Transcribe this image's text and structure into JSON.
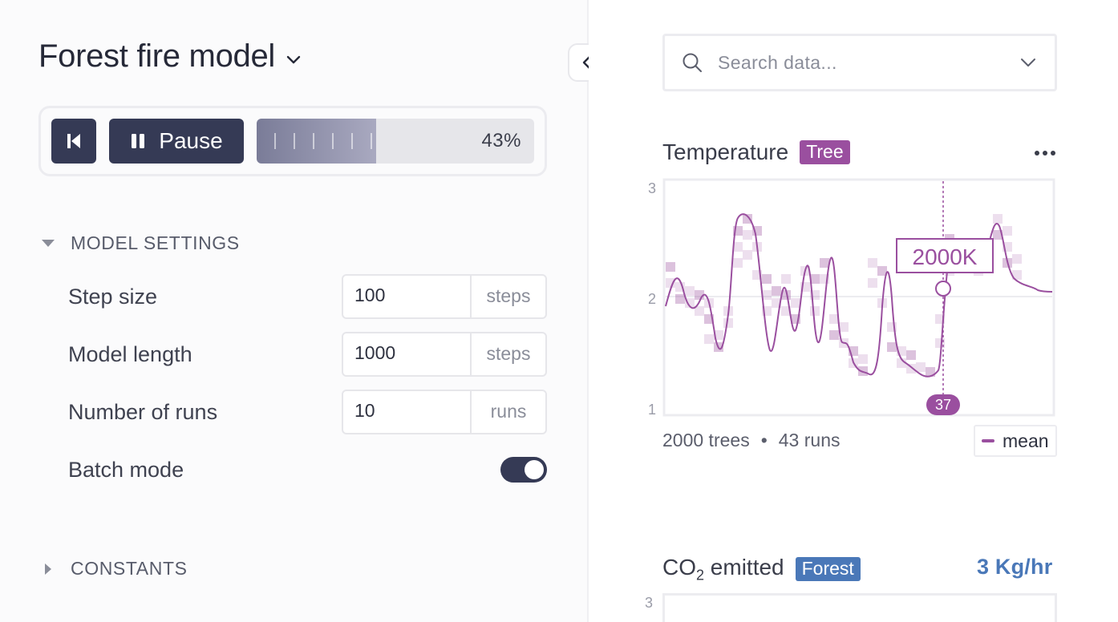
{
  "model": {
    "title": "Forest fire model"
  },
  "controls": {
    "pause_label": "Pause",
    "progress_value": 43,
    "progress_label": "43%"
  },
  "model_settings": {
    "heading": "MODEL SETTINGS",
    "expanded": true,
    "rows": [
      {
        "label": "Step size",
        "value": "100",
        "unit": "steps"
      },
      {
        "label": "Model length",
        "value": "1000",
        "unit": "steps"
      },
      {
        "label": "Number of runs",
        "value": "10",
        "unit": "runs"
      }
    ],
    "batch_mode_label": "Batch mode",
    "batch_mode_on": true
  },
  "constants": {
    "heading": "CONSTANTS",
    "expanded": false
  },
  "search": {
    "placeholder": "Search data..."
  },
  "temperature_chart": {
    "title": "Temperature",
    "badge": "Tree",
    "badge_color": "#9a4f9f",
    "line_color": "#9a4f9f",
    "y_ticks": [
      "3",
      "2",
      "1"
    ],
    "tooltip_value": "2000K",
    "cursor_step": "37",
    "footer_trees": "2000 trees",
    "footer_sep": "•",
    "footer_runs": "43 runs",
    "legend_label": "mean"
  },
  "co2_chart": {
    "title_prefix": "CO",
    "title_sub": "2",
    "title_suffix": " emitted",
    "badge": "Forest",
    "badge_color": "#4a78b8",
    "value": "3 Kg/hr",
    "y_tick_top": "3"
  },
  "icons": {
    "title_dropdown": "chevron-down-icon",
    "collapse": "chevron-left-icon",
    "rewind": "skip-back-icon",
    "pause": "pause-icon",
    "search": "search-icon",
    "search_dropdown": "chevron-down-icon",
    "more": "more-horizontal-icon"
  }
}
